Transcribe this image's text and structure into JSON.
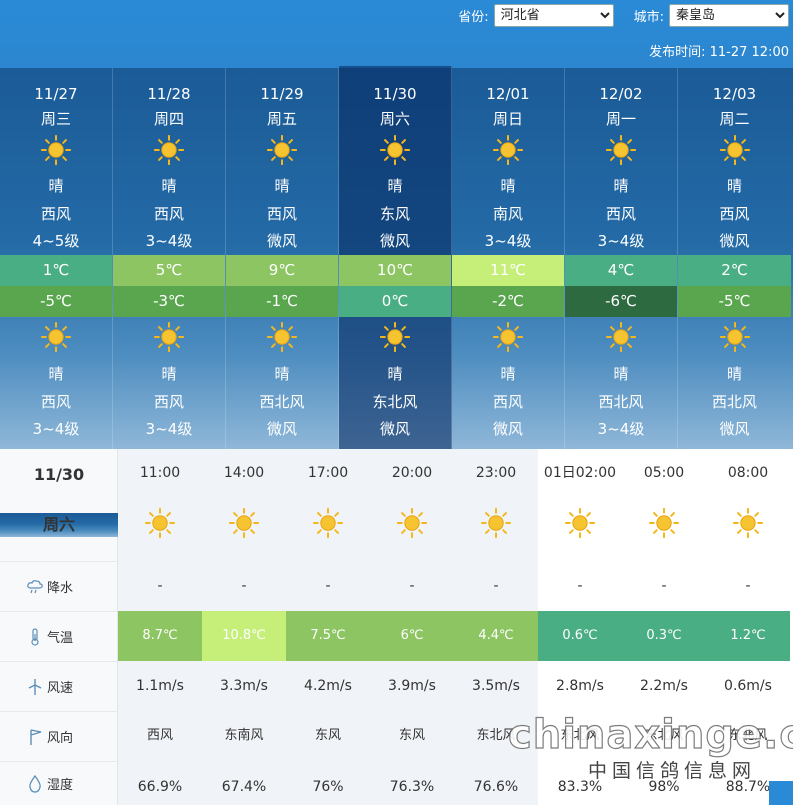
{
  "header": {
    "province_label": "省份:",
    "province_value": "河北省",
    "city_label": "城市:",
    "city_value": "秦皇岛",
    "publish_time": "发布时间:  11-27 12:00"
  },
  "days": [
    {
      "date": "11/27",
      "weekday": "周三",
      "day_weather": "晴",
      "day_wind_dir": "西风",
      "day_wind_level": "4~5级",
      "high": "1℃",
      "low": "-5℃",
      "night_weather": "晴",
      "night_wind_dir": "西风",
      "night_wind_level": "3~4级",
      "high_color": "#4aae84",
      "low_color": "#5aa64f"
    },
    {
      "date": "11/28",
      "weekday": "周四",
      "day_weather": "晴",
      "day_wind_dir": "西风",
      "day_wind_level": "3~4级",
      "high": "5℃",
      "low": "-3℃",
      "night_weather": "晴",
      "night_wind_dir": "西风",
      "night_wind_level": "3~4级",
      "high_color": "#8cc562",
      "low_color": "#5aa64f"
    },
    {
      "date": "11/29",
      "weekday": "周五",
      "day_weather": "晴",
      "day_wind_dir": "西风",
      "day_wind_level": "微风",
      "high": "9℃",
      "low": "-1℃",
      "night_weather": "晴",
      "night_wind_dir": "西北风",
      "night_wind_level": "微风",
      "high_color": "#8cc562",
      "low_color": "#5aa64f"
    },
    {
      "date": "11/30",
      "weekday": "周六",
      "day_weather": "晴",
      "day_wind_dir": "东风",
      "day_wind_level": "微风",
      "high": "10℃",
      "low": "0℃",
      "night_weather": "晴",
      "night_wind_dir": "东北风",
      "night_wind_level": "微风",
      "high_color": "#8cc562",
      "low_color": "#4aae84"
    },
    {
      "date": "12/01",
      "weekday": "周日",
      "day_weather": "晴",
      "day_wind_dir": "南风",
      "day_wind_level": "3~4级",
      "high": "11℃",
      "low": "-2℃",
      "night_weather": "晴",
      "night_wind_dir": "西风",
      "night_wind_level": "微风",
      "high_color": "#c6ef7a",
      "low_color": "#5aa64f"
    },
    {
      "date": "12/02",
      "weekday": "周一",
      "day_weather": "晴",
      "day_wind_dir": "西风",
      "day_wind_level": "3~4级",
      "high": "4℃",
      "low": "-6℃",
      "night_weather": "晴",
      "night_wind_dir": "西北风",
      "night_wind_level": "3~4级",
      "high_color": "#4aae84",
      "low_color": "#2e6a3f"
    },
    {
      "date": "12/03",
      "weekday": "周二",
      "day_weather": "晴",
      "day_wind_dir": "西风",
      "day_wind_level": "微风",
      "high": "2℃",
      "low": "-5℃",
      "night_weather": "晴",
      "night_wind_dir": "西北风",
      "night_wind_level": "微风",
      "high_color": "#4aae84",
      "low_color": "#5aa64f"
    }
  ],
  "selected_day_index": 3,
  "hourly": {
    "date": "11/30",
    "weekday": "周六",
    "labels": {
      "precip": "降水",
      "temp": "气温",
      "wind_speed": "风速",
      "wind_dir": "风向",
      "humidity": "湿度"
    },
    "hours": [
      {
        "time": "11:00",
        "precip": "-",
        "temp": "8.7℃",
        "wind_speed": "1.1m/s",
        "wind_dir": "西风",
        "humidity": "66.9%",
        "temp_color": "#8cc562"
      },
      {
        "time": "14:00",
        "precip": "-",
        "temp": "10.8℃",
        "wind_speed": "3.3m/s",
        "wind_dir": "东南风",
        "humidity": "67.4%",
        "temp_color": "#c6ef7a"
      },
      {
        "time": "17:00",
        "precip": "-",
        "temp": "7.5℃",
        "wind_speed": "4.2m/s",
        "wind_dir": "东风",
        "humidity": "76%",
        "temp_color": "#8cc562"
      },
      {
        "time": "20:00",
        "precip": "-",
        "temp": "6℃",
        "wind_speed": "3.9m/s",
        "wind_dir": "东风",
        "humidity": "76.3%",
        "temp_color": "#8cc562"
      },
      {
        "time": "23:00",
        "precip": "-",
        "temp": "4.4℃",
        "wind_speed": "3.5m/s",
        "wind_dir": "东北风",
        "humidity": "76.6%",
        "temp_color": "#8cc562"
      },
      {
        "time": "01日02:00",
        "precip": "-",
        "temp": "0.6℃",
        "wind_speed": "2.8m/s",
        "wind_dir": "东北风",
        "humidity": "83.3%",
        "temp_color": "#4aae84"
      },
      {
        "time": "05:00",
        "precip": "-",
        "temp": "0.3℃",
        "wind_speed": "2.2m/s",
        "wind_dir": "东北风",
        "humidity": "98%",
        "temp_color": "#4aae84"
      },
      {
        "time": "08:00",
        "precip": "-",
        "temp": "1.2℃",
        "wind_speed": "0.6m/s",
        "wind_dir": "东北风",
        "humidity": "88.7%",
        "temp_color": "#4aae84"
      }
    ]
  },
  "watermark": {
    "text": "chinaxinge.com",
    "sub": "中国信鸽信息网"
  }
}
